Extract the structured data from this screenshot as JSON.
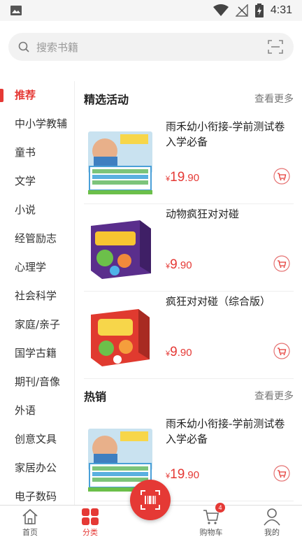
{
  "status_bar": {
    "time": "4:31"
  },
  "search": {
    "placeholder": "搜索书籍"
  },
  "sidebar": {
    "items": [
      {
        "label": "推荐",
        "active": true
      },
      {
        "label": "中小学教辅"
      },
      {
        "label": "童书"
      },
      {
        "label": "文学"
      },
      {
        "label": "小说"
      },
      {
        "label": "经管励志"
      },
      {
        "label": "心理学"
      },
      {
        "label": "社会科学"
      },
      {
        "label": "家庭/亲子"
      },
      {
        "label": "国学古籍"
      },
      {
        "label": "期刊/音像"
      },
      {
        "label": "外语"
      },
      {
        "label": "创意文具"
      },
      {
        "label": "家居办公"
      },
      {
        "label": "电子数码"
      }
    ]
  },
  "sections": [
    {
      "title": "精选活动",
      "more": "查看更多",
      "products": [
        {
          "name": "雨禾幼小衔接-学前测试卷入学必备",
          "currency": "¥",
          "price_int": "19",
          "price_dec": ".90",
          "image": "test-paper-box"
        },
        {
          "name": "动物疯狂对对碰",
          "currency": "¥",
          "price_int": "9",
          "price_dec": ".90",
          "image": "animal-cards-purple"
        },
        {
          "name": "疯狂对对碰（综合版）",
          "currency": "¥",
          "price_int": "9",
          "price_dec": ".90",
          "image": "cards-red"
        }
      ]
    },
    {
      "title": "热销",
      "more": "查看更多",
      "products": [
        {
          "name": "雨禾幼小衔接-学前测试卷入学必备",
          "currency": "¥",
          "price_int": "19",
          "price_dec": ".90",
          "image": "test-paper-box"
        }
      ]
    }
  ],
  "tabbar": {
    "items": [
      {
        "label": "首页",
        "icon": "home-icon"
      },
      {
        "label": "分类",
        "icon": "category-icon",
        "active": true
      },
      {
        "label": "",
        "icon": "barcode-scan-icon"
      },
      {
        "label": "购物车",
        "icon": "cart-icon",
        "badge": "4"
      },
      {
        "label": "我的",
        "icon": "user-icon"
      }
    ]
  },
  "colors": {
    "accent": "#e53935",
    "text": "#222222",
    "muted": "#777777"
  }
}
